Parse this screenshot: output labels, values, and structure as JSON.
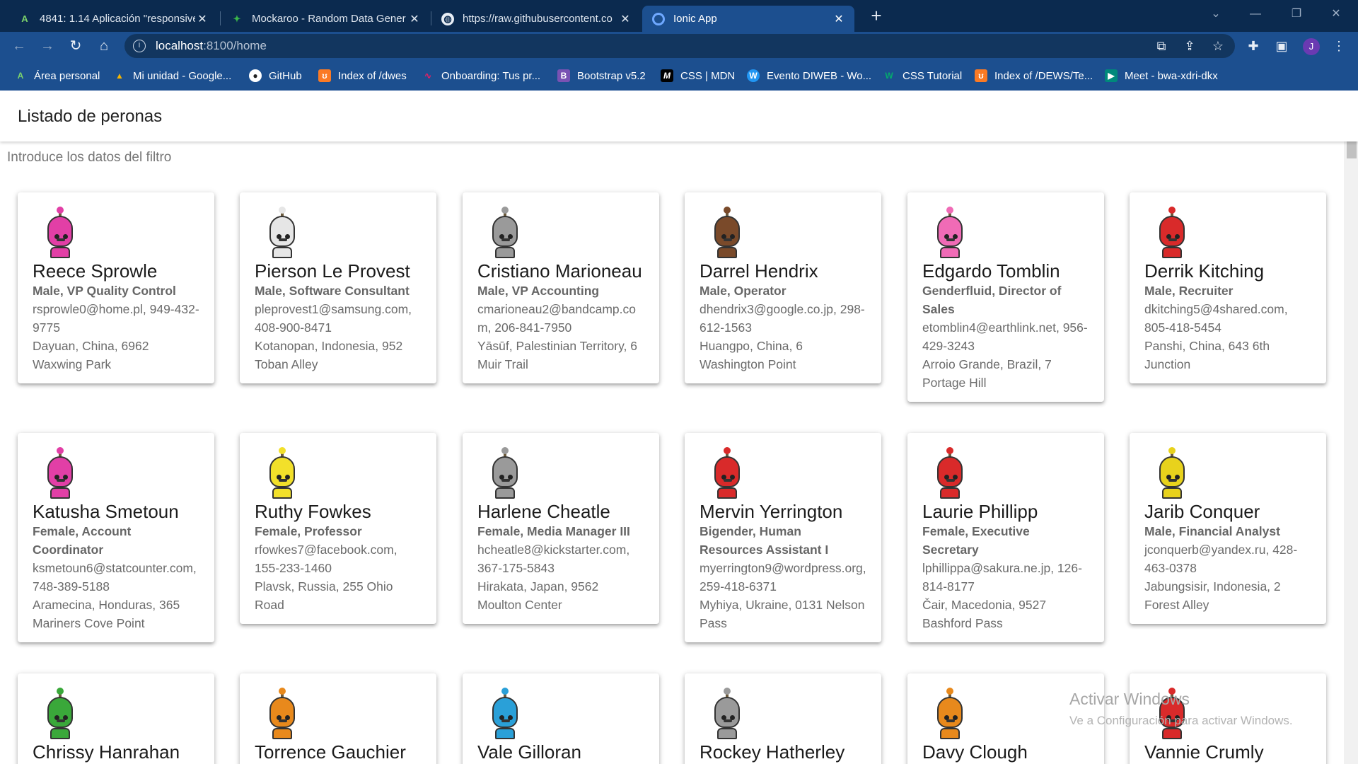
{
  "browser": {
    "tabs": [
      {
        "title": "4841: 1.14 Aplicación \"responsive",
        "icon": "moodle-icon",
        "active": false
      },
      {
        "title": "Mockaroo - Random Data Gener",
        "icon": "mockaroo-icon",
        "active": false
      },
      {
        "title": "https://raw.githubusercontent.co",
        "icon": "globe-icon",
        "active": false
      },
      {
        "title": "Ionic App",
        "icon": "ionic-icon",
        "active": true
      }
    ],
    "url_host": "localhost",
    "url_rest": ":8100/home",
    "profile_initial": "J",
    "bookmarks": [
      {
        "label": "Área personal",
        "icon": "moodle-icon",
        "color": "#2e7d32"
      },
      {
        "label": "Mi unidad - Google...",
        "icon": "drive-icon",
        "color": "#f4b400"
      },
      {
        "label": "GitHub",
        "icon": "github-icon",
        "color": "#222222"
      },
      {
        "label": "Index of /dwes",
        "icon": "xampp-icon",
        "color": "#fb7a24"
      },
      {
        "label": "Onboarding: Tus pr...",
        "icon": "onboarding-icon",
        "color": "#e91e63"
      },
      {
        "label": "Bootstrap v5.2",
        "icon": "bootstrap-icon",
        "color": "#7952b3"
      },
      {
        "label": "CSS | MDN",
        "icon": "mdn-icon",
        "color": "#000000"
      },
      {
        "label": "Evento DIWEB - Wo...",
        "icon": "wordpress-icon",
        "color": "#2196f3"
      },
      {
        "label": "CSS Tutorial",
        "icon": "w3schools-icon",
        "color": "#04aa6d"
      },
      {
        "label": "Index of /DEWS/Te...",
        "icon": "xampp-icon",
        "color": "#fb7a24"
      },
      {
        "label": "Meet - bwa-xdri-dkx",
        "icon": "meet-icon",
        "color": "#00897b"
      }
    ]
  },
  "app": {
    "title": "Listado de peronas",
    "filter_placeholder": "Introduce los datos del filtro"
  },
  "people": [
    {
      "name": "Reece Sprowle",
      "sub": "Male, VP Quality Control",
      "contact": "rsprowle0@home.pl, 949-432-9775",
      "address": "Dayuan, China, 6962 Waxwing Park",
      "color": "#e23fa6"
    },
    {
      "name": "Pierson Le Provest",
      "sub": "Male, Software Consultant",
      "contact": "pleprovest1@samsung.com, 408-900-8471",
      "address": "Kotanopan, Indonesia, 952 Toban Alley",
      "color": "#e6e6e6"
    },
    {
      "name": "Cristiano Marioneau",
      "sub": "Male, VP Accounting",
      "contact": "cmarioneau2@bandcamp.com, 206-841-7950",
      "address": "Yāsūf, Palestinian Territory, 6 Muir Trail",
      "color": "#9a9a9a"
    },
    {
      "name": "Darrel Hendrix",
      "sub": "Male, Operator",
      "contact": "dhendrix3@google.co.jp, 298-612-1563",
      "address": "Huangpo, China, 6 Washington Point",
      "color": "#7a4a2a"
    },
    {
      "name": "Edgardo Tomblin",
      "sub": "Genderfluid, Director of Sales",
      "contact": "etomblin4@earthlink.net, 956-429-3243",
      "address": "Arroio Grande, Brazil, 7 Portage Hill",
      "color": "#f06bb6"
    },
    {
      "name": "Derrik Kitching",
      "sub": "Male, Recruiter",
      "contact": "dkitching5@4shared.com, 805-418-5454",
      "address": "Panshi, China, 643 6th Junction",
      "color": "#d92a2a"
    },
    {
      "name": "Katusha Smetoun",
      "sub": "Female, Account Coordinator",
      "contact": "ksmetoun6@statcounter.com, 748-389-5188",
      "address": "Aramecina, Honduras, 365 Mariners Cove Point",
      "color": "#e23fa6"
    },
    {
      "name": "Ruthy Fowkes",
      "sub": "Female, Professor",
      "contact": "rfowkes7@facebook.com, 155-233-1460",
      "address": "Plavsk, Russia, 255 Ohio Road",
      "color": "#f2e02a"
    },
    {
      "name": "Harlene Cheatle",
      "sub": "Female, Media Manager III",
      "contact": "hcheatle8@kickstarter.com, 367-175-5843",
      "address": "Hirakata, Japan, 9562 Moulton Center",
      "color": "#9a9a9a"
    },
    {
      "name": "Mervin Yerrington",
      "sub": "Bigender, Human Resources Assistant I",
      "contact": "myerrington9@wordpress.org, 259-418-6371",
      "address": "Myhiya, Ukraine, 0131 Nelson Pass",
      "color": "#d92a2a"
    },
    {
      "name": "Laurie Phillipp",
      "sub": "Female, Executive Secretary",
      "contact": "lphillippa@sakura.ne.jp, 126-814-8177",
      "address": "Čair, Macedonia, 9527 Bashford Pass",
      "color": "#d92a2a"
    },
    {
      "name": "Jarib Conquer",
      "sub": "Male, Financial Analyst",
      "contact": "jconquerb@yandex.ru, 428-463-0378",
      "address": "Jabungsisir, Indonesia, 2 Forest Alley",
      "color": "#e8d21c"
    },
    {
      "name": "Chrissy Hanrahan",
      "sub": "",
      "contact": "",
      "address": "",
      "color": "#3aa83a"
    },
    {
      "name": "Torrence Gauchier",
      "sub": "",
      "contact": "",
      "address": "",
      "color": "#e8891c"
    },
    {
      "name": "Vale Gilloran",
      "sub": "",
      "contact": "",
      "address": "",
      "color": "#2aa0d8"
    },
    {
      "name": "Rockey Hatherley",
      "sub": "",
      "contact": "",
      "address": "",
      "color": "#9a9a9a"
    },
    {
      "name": "Davy Clough",
      "sub": "",
      "contact": "",
      "address": "",
      "color": "#e8891c"
    },
    {
      "name": "Vannie Crumly",
      "sub": "",
      "contact": "",
      "address": "",
      "color": "#d92a2a"
    }
  ],
  "watermark": {
    "line1": "Activar Windows",
    "line2": "Ve a Configuración para activar Windows."
  }
}
